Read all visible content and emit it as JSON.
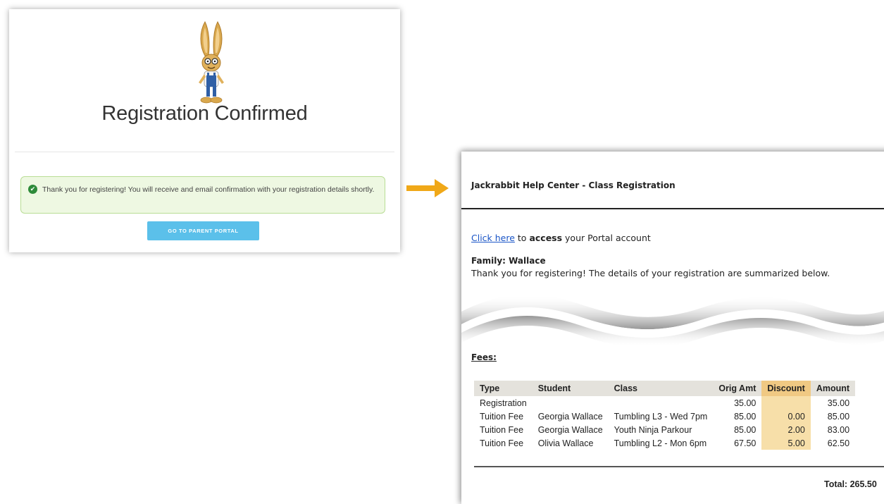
{
  "confirmation": {
    "title": "Registration Confirmed",
    "alert_text": "Thank you for registering! You will receive and email confirmation with your registration details shortly.",
    "portal_button": "GO TO PARENT PORTAL",
    "success_color": "#2e8b3a",
    "button_color": "#5bc0ea"
  },
  "arrow": {
    "icon": "right-arrow-icon",
    "color": "#f0a818"
  },
  "email": {
    "title": "Jackrabbit Help Center - Class Registration",
    "portal_link": "Click here",
    "portal_text_1": " to ",
    "portal_text_bold": "access",
    "portal_text_2": " your Portal account",
    "family": "Family: Wallace",
    "thanks": "Thank you for registering! The details of your registration are summarized below.",
    "fees_label": "Fees:",
    "columns": [
      "Type",
      "Student",
      "Class",
      "Orig Amt",
      "Discount",
      "Amount"
    ],
    "rows": [
      [
        "Registration",
        "",
        "",
        "35.00",
        "",
        "35.00"
      ],
      [
        "Tuition Fee",
        "Georgia Wallace",
        "Tumbling L3 - Wed 7pm",
        "85.00",
        "0.00",
        "85.00"
      ],
      [
        "Tuition Fee",
        "Georgia Wallace",
        "Youth Ninja Parkour",
        "85.00",
        "2.00",
        "83.00"
      ],
      [
        "Tuition Fee",
        "Olivia Wallace",
        "Tumbling L2 - Mon 6pm",
        "67.50",
        "5.00",
        "62.50"
      ]
    ],
    "total": "Total: 265.50"
  }
}
